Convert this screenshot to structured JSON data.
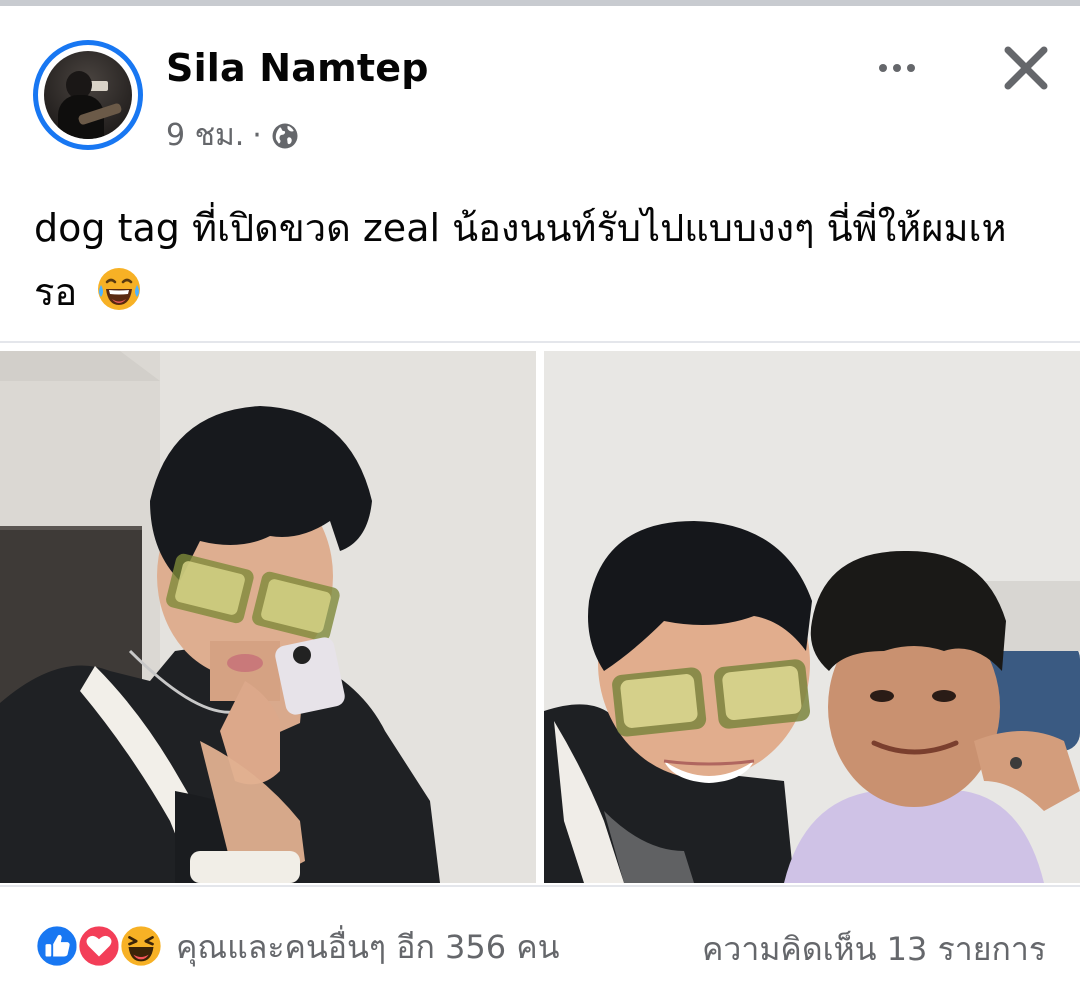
{
  "post": {
    "author_name": "Sila Namtep",
    "time": "9 ชม.",
    "separator": "·",
    "privacy_icon": "globe-icon",
    "caption": "dog tag ที่เปิดขวด zeal น้องนนท์รับไปแบบงงๆ นี่พี่ให้ผมเหรอ",
    "caption_emoji": "laughing-tears-emoji"
  },
  "actions": {
    "more_icon": "more-horizontal-icon",
    "close_icon": "close-icon"
  },
  "photos": [
    {
      "name": "photo-1"
    },
    {
      "name": "photo-2"
    }
  ],
  "footer": {
    "reaction_icons": [
      "like-icon",
      "love-icon",
      "haha-icon"
    ],
    "reactions_text": "คุณและคนอื่นๆ อีก 356 คน",
    "comments_text": "ความคิดเห็น 13 รายการ"
  },
  "colors": {
    "accent": "#1877f2",
    "secondary_text": "#65676b",
    "love": "#f33e58",
    "haha": "#f7b125"
  }
}
